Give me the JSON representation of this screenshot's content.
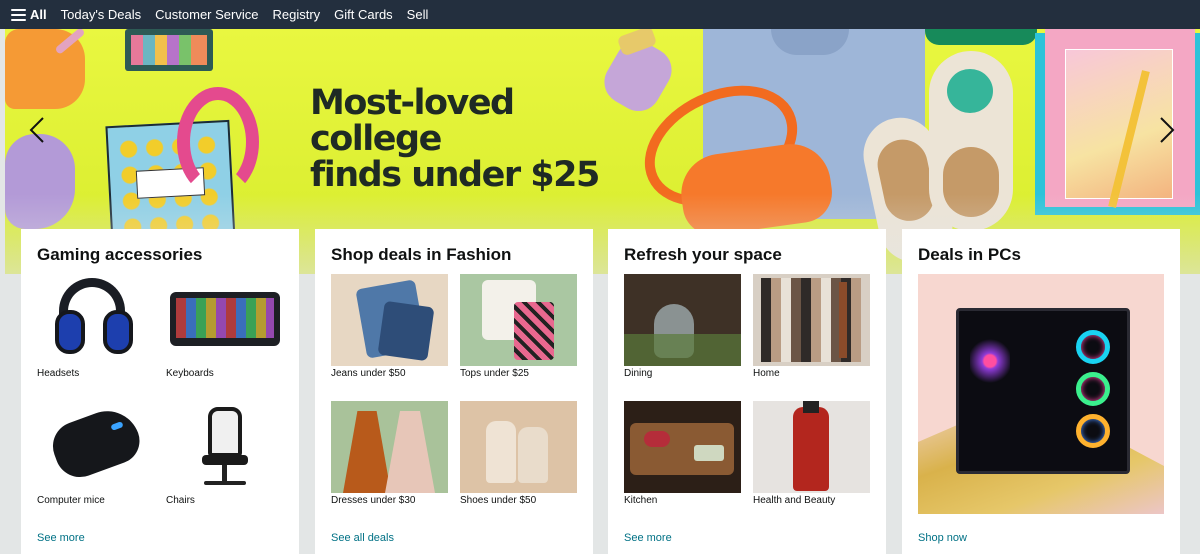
{
  "nav": {
    "all_label": "All",
    "links": [
      "Today's Deals",
      "Customer Service",
      "Registry",
      "Gift Cards",
      "Sell"
    ]
  },
  "hero": {
    "title_line1": "Most-loved college",
    "title_line2": "finds under $25"
  },
  "cards": [
    {
      "title": "Gaming accessories",
      "tiles": [
        "Headsets",
        "Keyboards",
        "Computer mice",
        "Chairs"
      ],
      "link": "See more"
    },
    {
      "title": "Shop deals in Fashion",
      "tiles": [
        "Jeans under $50",
        "Tops under $25",
        "Dresses under $30",
        "Shoes under $50"
      ],
      "link": "See all deals"
    },
    {
      "title": "Refresh your space",
      "tiles": [
        "Dining",
        "Home",
        "Kitchen",
        "Health and Beauty"
      ],
      "link": "See more"
    },
    {
      "title": "Deals in PCs",
      "link": "Shop now"
    }
  ],
  "icons": [
    "menu-icon",
    "chevron-left-icon",
    "chevron-right-icon"
  ],
  "colors": {
    "nav_bg": "#232f3e",
    "hero_bg": "#e3f23c",
    "link": "#007185",
    "page_bg": "#e3e6e6"
  }
}
